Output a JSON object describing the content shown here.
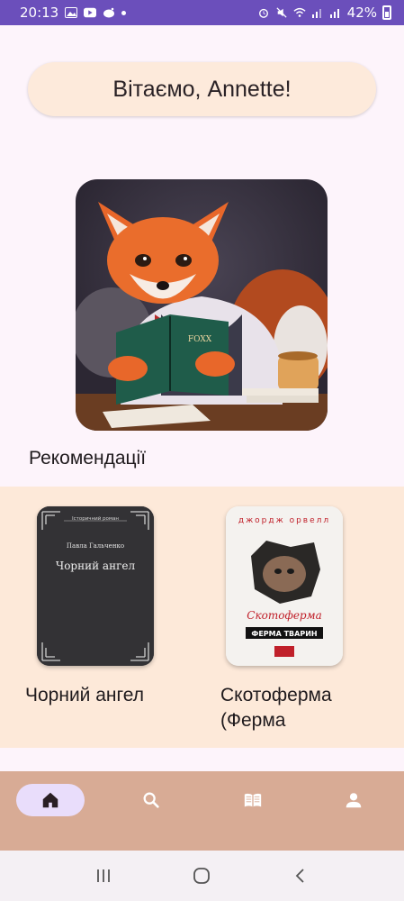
{
  "status_bar": {
    "time": "20:13",
    "battery": "42%"
  },
  "greeting": "Вітаємо, Annette!",
  "hero": {
    "icon": "fox-reading-book",
    "book_label": "FOXX"
  },
  "recommendations": {
    "title": "Рекомендації",
    "books": [
      {
        "title": "Чорний ангел",
        "cover_series": "Історичний роман",
        "cover_author": "Павла Гальченко",
        "cover_title": "Чорний ангел"
      },
      {
        "title": "Скотоферма (Ферма",
        "cover_author": "джордж орвелл",
        "cover_title": "Скотоферма",
        "cover_subtitle": "ФЕРМА ТВАРИН"
      }
    ]
  },
  "bottom_nav": {
    "items": [
      {
        "icon": "home-icon",
        "active": true
      },
      {
        "icon": "search-icon",
        "active": false
      },
      {
        "icon": "book-open-icon",
        "active": false
      },
      {
        "icon": "person-icon",
        "active": false
      }
    ],
    "background": "#d8ab95",
    "active_pill": "#e9ddfb"
  },
  "colors": {
    "status_bar": "#6b4fbb",
    "page": "#fdf4fb",
    "greeting_bg": "#fdeadb",
    "panel_bg": "#fde9d9"
  }
}
